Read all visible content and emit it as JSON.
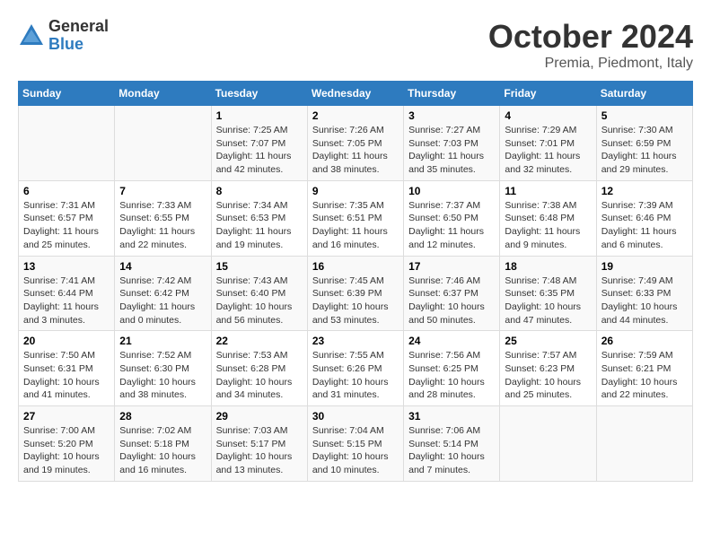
{
  "header": {
    "logo_general": "General",
    "logo_blue": "Blue",
    "month_title": "October 2024",
    "location": "Premia, Piedmont, Italy"
  },
  "days_of_week": [
    "Sunday",
    "Monday",
    "Tuesday",
    "Wednesday",
    "Thursday",
    "Friday",
    "Saturday"
  ],
  "weeks": [
    [
      {
        "day": "",
        "sunrise": "",
        "sunset": "",
        "daylight": ""
      },
      {
        "day": "",
        "sunrise": "",
        "sunset": "",
        "daylight": ""
      },
      {
        "day": "1",
        "sunrise": "Sunrise: 7:25 AM",
        "sunset": "Sunset: 7:07 PM",
        "daylight": "Daylight: 11 hours and 42 minutes."
      },
      {
        "day": "2",
        "sunrise": "Sunrise: 7:26 AM",
        "sunset": "Sunset: 7:05 PM",
        "daylight": "Daylight: 11 hours and 38 minutes."
      },
      {
        "day": "3",
        "sunrise": "Sunrise: 7:27 AM",
        "sunset": "Sunset: 7:03 PM",
        "daylight": "Daylight: 11 hours and 35 minutes."
      },
      {
        "day": "4",
        "sunrise": "Sunrise: 7:29 AM",
        "sunset": "Sunset: 7:01 PM",
        "daylight": "Daylight: 11 hours and 32 minutes."
      },
      {
        "day": "5",
        "sunrise": "Sunrise: 7:30 AM",
        "sunset": "Sunset: 6:59 PM",
        "daylight": "Daylight: 11 hours and 29 minutes."
      }
    ],
    [
      {
        "day": "6",
        "sunrise": "Sunrise: 7:31 AM",
        "sunset": "Sunset: 6:57 PM",
        "daylight": "Daylight: 11 hours and 25 minutes."
      },
      {
        "day": "7",
        "sunrise": "Sunrise: 7:33 AM",
        "sunset": "Sunset: 6:55 PM",
        "daylight": "Daylight: 11 hours and 22 minutes."
      },
      {
        "day": "8",
        "sunrise": "Sunrise: 7:34 AM",
        "sunset": "Sunset: 6:53 PM",
        "daylight": "Daylight: 11 hours and 19 minutes."
      },
      {
        "day": "9",
        "sunrise": "Sunrise: 7:35 AM",
        "sunset": "Sunset: 6:51 PM",
        "daylight": "Daylight: 11 hours and 16 minutes."
      },
      {
        "day": "10",
        "sunrise": "Sunrise: 7:37 AM",
        "sunset": "Sunset: 6:50 PM",
        "daylight": "Daylight: 11 hours and 12 minutes."
      },
      {
        "day": "11",
        "sunrise": "Sunrise: 7:38 AM",
        "sunset": "Sunset: 6:48 PM",
        "daylight": "Daylight: 11 hours and 9 minutes."
      },
      {
        "day": "12",
        "sunrise": "Sunrise: 7:39 AM",
        "sunset": "Sunset: 6:46 PM",
        "daylight": "Daylight: 11 hours and 6 minutes."
      }
    ],
    [
      {
        "day": "13",
        "sunrise": "Sunrise: 7:41 AM",
        "sunset": "Sunset: 6:44 PM",
        "daylight": "Daylight: 11 hours and 3 minutes."
      },
      {
        "day": "14",
        "sunrise": "Sunrise: 7:42 AM",
        "sunset": "Sunset: 6:42 PM",
        "daylight": "Daylight: 11 hours and 0 minutes."
      },
      {
        "day": "15",
        "sunrise": "Sunrise: 7:43 AM",
        "sunset": "Sunset: 6:40 PM",
        "daylight": "Daylight: 10 hours and 56 minutes."
      },
      {
        "day": "16",
        "sunrise": "Sunrise: 7:45 AM",
        "sunset": "Sunset: 6:39 PM",
        "daylight": "Daylight: 10 hours and 53 minutes."
      },
      {
        "day": "17",
        "sunrise": "Sunrise: 7:46 AM",
        "sunset": "Sunset: 6:37 PM",
        "daylight": "Daylight: 10 hours and 50 minutes."
      },
      {
        "day": "18",
        "sunrise": "Sunrise: 7:48 AM",
        "sunset": "Sunset: 6:35 PM",
        "daylight": "Daylight: 10 hours and 47 minutes."
      },
      {
        "day": "19",
        "sunrise": "Sunrise: 7:49 AM",
        "sunset": "Sunset: 6:33 PM",
        "daylight": "Daylight: 10 hours and 44 minutes."
      }
    ],
    [
      {
        "day": "20",
        "sunrise": "Sunrise: 7:50 AM",
        "sunset": "Sunset: 6:31 PM",
        "daylight": "Daylight: 10 hours and 41 minutes."
      },
      {
        "day": "21",
        "sunrise": "Sunrise: 7:52 AM",
        "sunset": "Sunset: 6:30 PM",
        "daylight": "Daylight: 10 hours and 38 minutes."
      },
      {
        "day": "22",
        "sunrise": "Sunrise: 7:53 AM",
        "sunset": "Sunset: 6:28 PM",
        "daylight": "Daylight: 10 hours and 34 minutes."
      },
      {
        "day": "23",
        "sunrise": "Sunrise: 7:55 AM",
        "sunset": "Sunset: 6:26 PM",
        "daylight": "Daylight: 10 hours and 31 minutes."
      },
      {
        "day": "24",
        "sunrise": "Sunrise: 7:56 AM",
        "sunset": "Sunset: 6:25 PM",
        "daylight": "Daylight: 10 hours and 28 minutes."
      },
      {
        "day": "25",
        "sunrise": "Sunrise: 7:57 AM",
        "sunset": "Sunset: 6:23 PM",
        "daylight": "Daylight: 10 hours and 25 minutes."
      },
      {
        "day": "26",
        "sunrise": "Sunrise: 7:59 AM",
        "sunset": "Sunset: 6:21 PM",
        "daylight": "Daylight: 10 hours and 22 minutes."
      }
    ],
    [
      {
        "day": "27",
        "sunrise": "Sunrise: 7:00 AM",
        "sunset": "Sunset: 5:20 PM",
        "daylight": "Daylight: 10 hours and 19 minutes."
      },
      {
        "day": "28",
        "sunrise": "Sunrise: 7:02 AM",
        "sunset": "Sunset: 5:18 PM",
        "daylight": "Daylight: 10 hours and 16 minutes."
      },
      {
        "day": "29",
        "sunrise": "Sunrise: 7:03 AM",
        "sunset": "Sunset: 5:17 PM",
        "daylight": "Daylight: 10 hours and 13 minutes."
      },
      {
        "day": "30",
        "sunrise": "Sunrise: 7:04 AM",
        "sunset": "Sunset: 5:15 PM",
        "daylight": "Daylight: 10 hours and 10 minutes."
      },
      {
        "day": "31",
        "sunrise": "Sunrise: 7:06 AM",
        "sunset": "Sunset: 5:14 PM",
        "daylight": "Daylight: 10 hours and 7 minutes."
      },
      {
        "day": "",
        "sunrise": "",
        "sunset": "",
        "daylight": ""
      },
      {
        "day": "",
        "sunrise": "",
        "sunset": "",
        "daylight": ""
      }
    ]
  ]
}
